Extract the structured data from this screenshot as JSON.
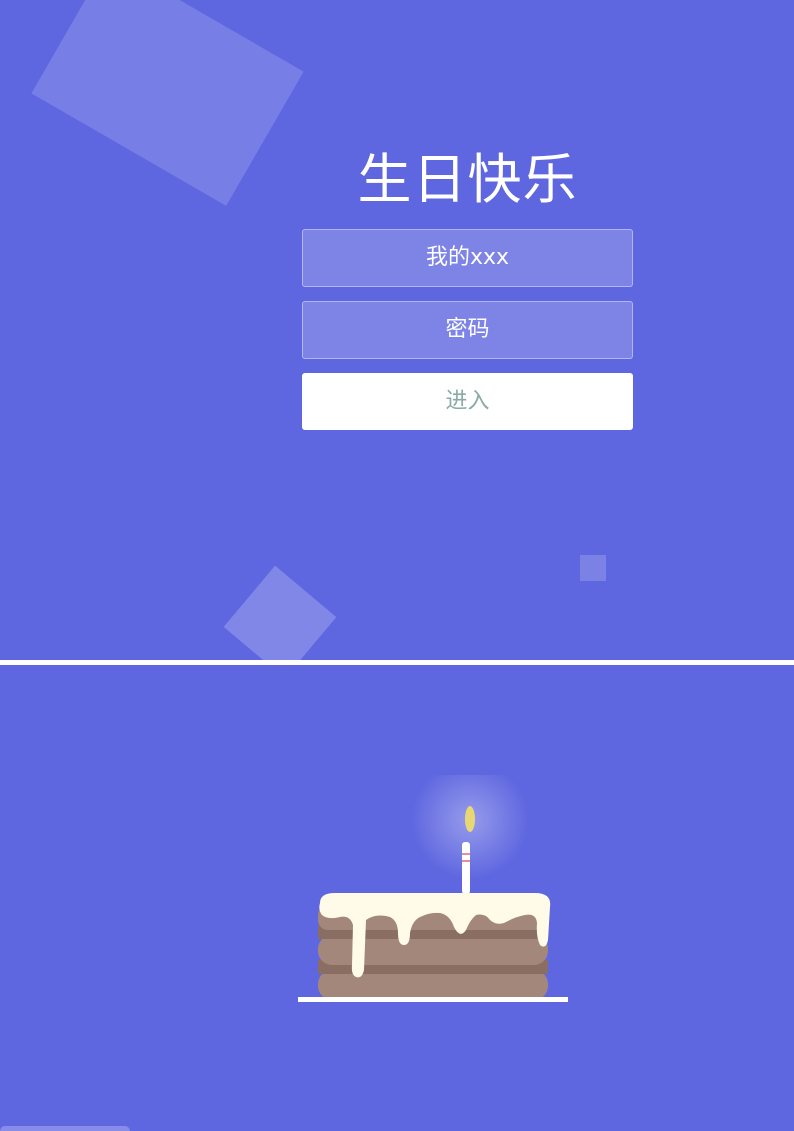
{
  "login": {
    "title": "生日快乐",
    "username_placeholder": "我的xxx",
    "password_placeholder": "密码",
    "enter_label": "进入"
  },
  "colors": {
    "background": "#5e66e0",
    "button_text": "#8aaaa6",
    "cake_brown": "#a4877b",
    "cake_dark_brown": "#8a6e63",
    "icing": "#fffbe8",
    "flame": "#e8d873"
  },
  "cake": {
    "icons": [
      "candle-icon",
      "flame-icon",
      "cake-icon"
    ]
  }
}
